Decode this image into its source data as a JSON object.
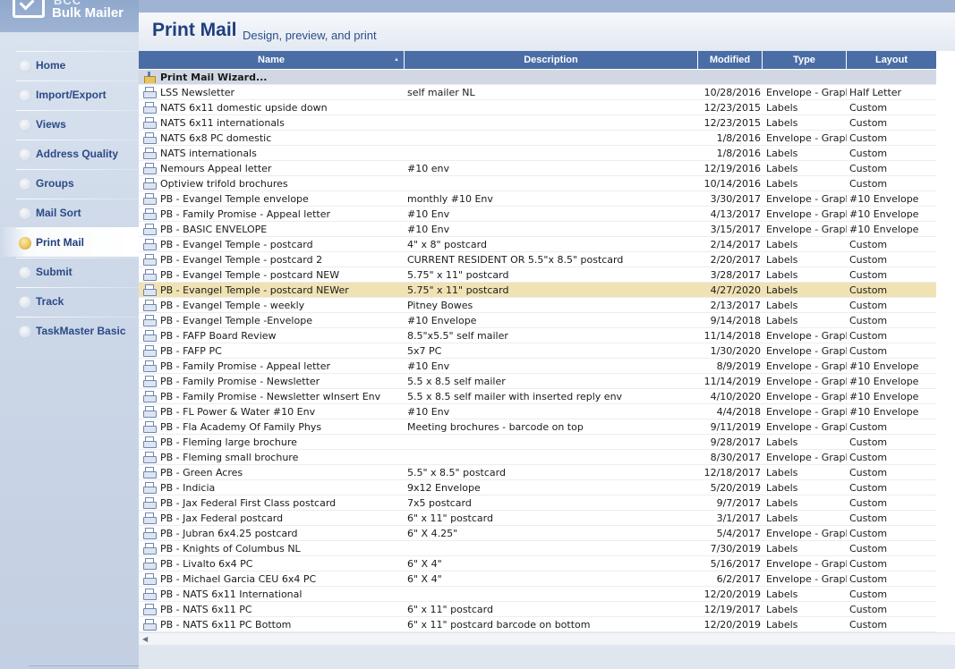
{
  "app": {
    "brand_small": "BCC",
    "brand_name": "Bulk Mailer"
  },
  "sidebar": {
    "items": [
      {
        "label": "Home",
        "active": false
      },
      {
        "label": "Import/Export",
        "active": false
      },
      {
        "label": "Views",
        "active": false
      },
      {
        "label": "Address Quality",
        "active": false
      },
      {
        "label": "Groups",
        "active": false
      },
      {
        "label": "Mail Sort",
        "active": false
      },
      {
        "label": "Print Mail",
        "active": true
      },
      {
        "label": "Submit",
        "active": false
      },
      {
        "label": "Track",
        "active": false
      },
      {
        "label": "TaskMaster Basic",
        "active": false
      }
    ]
  },
  "header": {
    "title": "Print Mail",
    "subtitle": "Design, preview, and print"
  },
  "table": {
    "columns": [
      "Name",
      "Description",
      "Modified",
      "Type",
      "Layout"
    ],
    "sorted_column": "Name",
    "wizard_row": "Print Mail Wizard...",
    "selected_index": 13,
    "rows": [
      {
        "name": "LSS Newsletter",
        "desc": "self mailer NL",
        "mod": "10/28/2016",
        "type": "Envelope - Graph",
        "layout": "Half Letter"
      },
      {
        "name": "NATS 6x11 domestic upside down",
        "desc": "",
        "mod": "12/23/2015",
        "type": "Labels",
        "layout": "Custom"
      },
      {
        "name": "NATS 6x11 internationals",
        "desc": "",
        "mod": "12/23/2015",
        "type": "Labels",
        "layout": "Custom"
      },
      {
        "name": "NATS 6x8 PC domestic",
        "desc": "",
        "mod": "1/8/2016",
        "type": "Envelope - Graph",
        "layout": "Custom"
      },
      {
        "name": "NATS internationals",
        "desc": "",
        "mod": "1/8/2016",
        "type": "Labels",
        "layout": "Custom"
      },
      {
        "name": "Nemours Appeal letter",
        "desc": "#10 env",
        "mod": "12/19/2016",
        "type": "Labels",
        "layout": "Custom"
      },
      {
        "name": "Optiview trifold brochures",
        "desc": "",
        "mod": "10/14/2016",
        "type": "Labels",
        "layout": "Custom"
      },
      {
        "name": "PB -  Evangel Temple envelope",
        "desc": "monthly #10 Env",
        "mod": "3/30/2017",
        "type": "Envelope - Graph",
        "layout": "#10 Envelope"
      },
      {
        "name": "PB -  Family Promise - Appeal letter",
        "desc": "#10 Env",
        "mod": "4/13/2017",
        "type": "Envelope - Graph",
        "layout": "#10 Envelope"
      },
      {
        "name": "PB - BASIC ENVELOPE",
        "desc": "#10 Env",
        "mod": "3/15/2017",
        "type": "Envelope - Graph",
        "layout": "#10 Envelope"
      },
      {
        "name": "PB - Evangel Temple - postcard",
        "desc": "4\" x 8\" postcard",
        "mod": "2/14/2017",
        "type": "Labels",
        "layout": "Custom"
      },
      {
        "name": "PB - Evangel Temple - postcard 2",
        "desc": "CURRENT RESIDENT OR 5.5\"x 8.5\" postcard",
        "mod": "2/20/2017",
        "type": "Labels",
        "layout": "Custom"
      },
      {
        "name": "PB - Evangel Temple - postcard NEW",
        "desc": "5.75\" x 11\" postcard",
        "mod": "3/28/2017",
        "type": "Labels",
        "layout": "Custom"
      },
      {
        "name": "PB - Evangel Temple - postcard NEWer",
        "desc": "5.75\" x 11\" postcard",
        "mod": "4/27/2020",
        "type": "Labels",
        "layout": "Custom"
      },
      {
        "name": "PB - Evangel Temple - weekly",
        "desc": "Pitney Bowes",
        "mod": "2/13/2017",
        "type": "Labels",
        "layout": "Custom"
      },
      {
        "name": "PB - Evangel Temple -Envelope",
        "desc": "#10 Envelope",
        "mod": "9/14/2018",
        "type": "Labels",
        "layout": "Custom"
      },
      {
        "name": "PB - FAFP Board Review",
        "desc": "8.5\"x5.5\" self mailer",
        "mod": "11/14/2018",
        "type": "Envelope - Graph",
        "layout": "Custom"
      },
      {
        "name": "PB - FAFP PC",
        "desc": "5x7 PC",
        "mod": "1/30/2020",
        "type": "Envelope - Graph",
        "layout": "Custom"
      },
      {
        "name": "PB - Family Promise - Appeal letter",
        "desc": "#10 Env",
        "mod": "8/9/2019",
        "type": "Envelope - Graph",
        "layout": "#10 Envelope"
      },
      {
        "name": "PB - Family Promise - Newsletter",
        "desc": "5.5 x 8.5 self mailer",
        "mod": "11/14/2019",
        "type": "Envelope - Graph",
        "layout": "#10 Envelope"
      },
      {
        "name": "PB - Family Promise - Newsletter wInsert Env",
        "desc": "5.5 x 8.5 self mailer with inserted reply env",
        "mod": "4/10/2020",
        "type": "Envelope - Graph",
        "layout": "#10 Envelope"
      },
      {
        "name": "PB - FL Power & Water #10 Env",
        "desc": "#10 Env",
        "mod": "4/4/2018",
        "type": "Envelope - Graph",
        "layout": "#10 Envelope"
      },
      {
        "name": "PB - Fla Academy Of Family Phys",
        "desc": "Meeting brochures - barcode on top",
        "mod": "9/11/2019",
        "type": "Envelope - Graph",
        "layout": "Custom"
      },
      {
        "name": "PB - Fleming large brochure",
        "desc": "",
        "mod": "9/28/2017",
        "type": "Labels",
        "layout": "Custom"
      },
      {
        "name": "PB - Fleming small brochure",
        "desc": "",
        "mod": "8/30/2017",
        "type": "Envelope - Graph",
        "layout": "Custom"
      },
      {
        "name": "PB - Green Acres",
        "desc": "5.5\" x 8.5\" postcard",
        "mod": "12/18/2017",
        "type": "Labels",
        "layout": "Custom"
      },
      {
        "name": "PB - Indicia",
        "desc": "9x12 Envelope",
        "mod": "5/20/2019",
        "type": "Labels",
        "layout": "Custom"
      },
      {
        "name": "PB - Jax Federal First Class postcard",
        "desc": "7x5 postcard",
        "mod": "9/7/2017",
        "type": "Labels",
        "layout": "Custom"
      },
      {
        "name": "PB - Jax Federal postcard",
        "desc": "6\" x 11\" postcard",
        "mod": "3/1/2017",
        "type": "Labels",
        "layout": "Custom"
      },
      {
        "name": "PB - Jubran 6x4.25 postcard",
        "desc": "6\" X 4.25\"",
        "mod": "5/4/2017",
        "type": "Envelope - Graph",
        "layout": "Custom"
      },
      {
        "name": "PB - Knights of Columbus NL",
        "desc": "",
        "mod": "7/30/2019",
        "type": "Labels",
        "layout": "Custom"
      },
      {
        "name": "PB - Livalto 6x4 PC",
        "desc": "6\" X 4\"",
        "mod": "5/16/2017",
        "type": "Envelope - Graph",
        "layout": "Custom"
      },
      {
        "name": "PB - Michael Garcia CEU 6x4 PC",
        "desc": "6\" X 4\"",
        "mod": "6/2/2017",
        "type": "Envelope - Graph",
        "layout": "Custom"
      },
      {
        "name": "PB - NATS 6x11 International",
        "desc": "",
        "mod": "12/20/2019",
        "type": "Labels",
        "layout": "Custom"
      },
      {
        "name": "PB - NATS 6x11 PC",
        "desc": "6\" x 11\" postcard",
        "mod": "12/19/2017",
        "type": "Labels",
        "layout": "Custom"
      },
      {
        "name": "PB - NATS 6x11 PC Bottom",
        "desc": "6\" x 11\" postcard barcode on bottom",
        "mod": "12/20/2019",
        "type": "Labels",
        "layout": "Custom"
      }
    ]
  },
  "colors": {
    "header_bg": "#4a6da5",
    "selected_row": "#f1e2b4",
    "nav_text": "#2b4a86",
    "title_text": "#1f3f7c"
  },
  "icons": {
    "row_icon": "printer-icon",
    "wizard_icon": "wizard-icon",
    "scroll_left": "scroll-left-arrow-icon"
  }
}
